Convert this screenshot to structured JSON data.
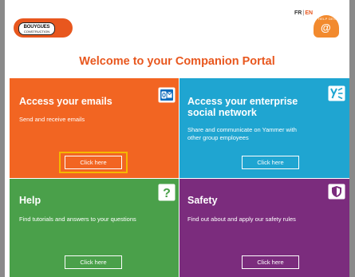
{
  "header": {
    "logo_line1": "BOUYGUES",
    "logo_line2": "CONSTRUCTION",
    "lang_fr": "FR",
    "lang_sep": "|",
    "lang_en": "EN",
    "badge_text": "HELP DESK",
    "badge_symbol": "@"
  },
  "page_title": "Welcome to your Companion Portal",
  "tiles": [
    {
      "title": "Access your emails",
      "description": "Send and receive emails",
      "button": "Click here",
      "icon": "outlook-icon",
      "color": "#f26522",
      "highlighted": true
    },
    {
      "title": "Access your enterprise social network",
      "description": "Share and communicate on Yammer with other group employees",
      "button": "Click here",
      "icon": "yammer-icon",
      "color": "#1fa5d1"
    },
    {
      "title": "Help",
      "description": "Find tutorials and answers to your questions",
      "button": "Click here",
      "icon": "question-icon",
      "color": "#4aa04a"
    },
    {
      "title": "Safety",
      "description": "Find out about and apply our safety rules",
      "button": "Click here",
      "icon": "shield-icon",
      "color": "#7b2c7d"
    }
  ],
  "colors": {
    "brand": "#e8571e",
    "highlight": "#f5b800"
  }
}
